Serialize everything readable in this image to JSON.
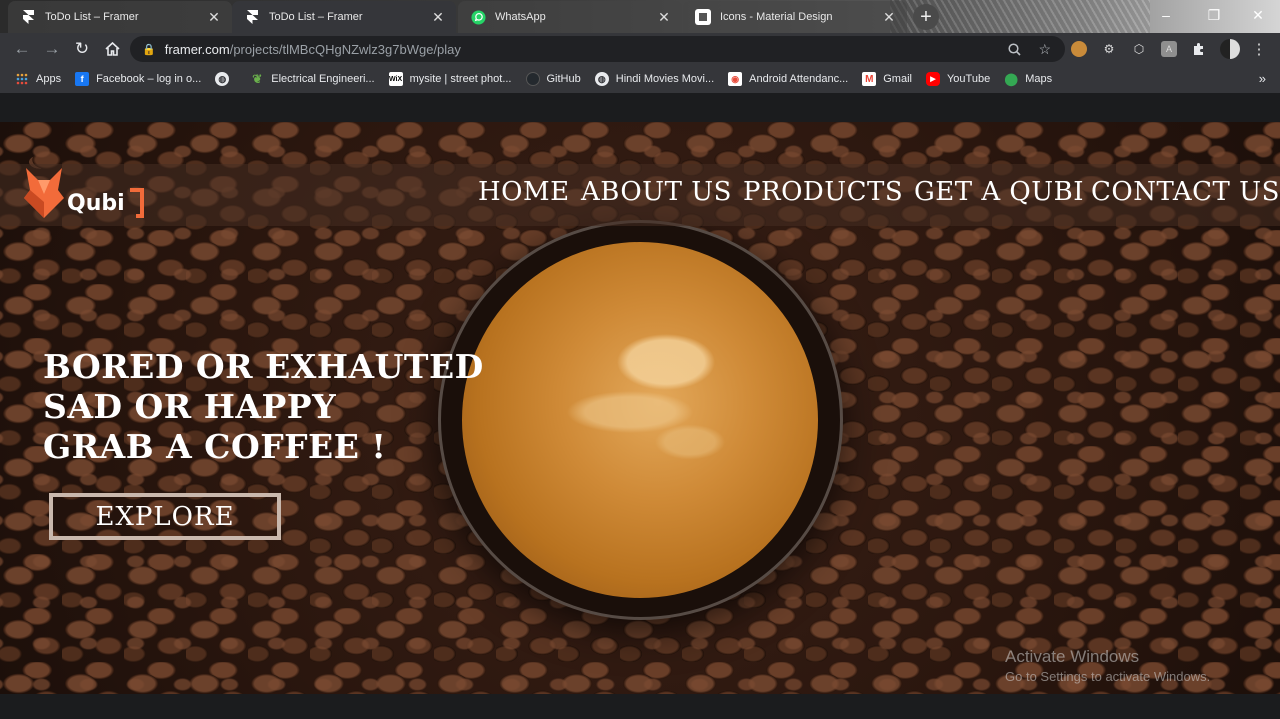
{
  "tabs": [
    {
      "title": "ToDo List – Framer",
      "favicon": "framer-icon",
      "state": "inactive"
    },
    {
      "title": "ToDo List – Framer",
      "favicon": "framer-icon",
      "state": "active"
    },
    {
      "title": "WhatsApp",
      "favicon": "whatsapp-icon",
      "state": "inactive"
    },
    {
      "title": "Icons - Material Design",
      "favicon": "material-icon",
      "state": "inactive"
    }
  ],
  "new_tab_label": "+",
  "window_controls": {
    "minimize": "–",
    "maximize": "❐",
    "close": "✕"
  },
  "address_bar": {
    "host": "framer.com",
    "path": "/projects/tlMBcQHgNZwlz3g7bWge/play"
  },
  "bookmarks": [
    {
      "label": "Apps",
      "icon": "apps-grid-icon",
      "color": "#e8eaed"
    },
    {
      "label": "Facebook – log in o...",
      "icon": "facebook-icon",
      "color": "#1877f2"
    },
    {
      "label": "",
      "icon": "globe-icon",
      "color": "#e8eaed"
    },
    {
      "label": "Electrical Engineeri...",
      "icon": "leaf-icon",
      "color": "#6ab04c"
    },
    {
      "label": "mysite | street phot...",
      "icon": "wix-icon",
      "color": "#ffffff"
    },
    {
      "label": "GitHub",
      "icon": "github-icon",
      "color": "#24292e"
    },
    {
      "label": "Hindi Movies Movi...",
      "icon": "globe-icon",
      "color": "#e8eaed"
    },
    {
      "label": "Android Attendanc...",
      "icon": "android-attendance-icon",
      "color": "#e74c3c"
    },
    {
      "label": "Gmail",
      "icon": "gmail-icon",
      "color": "#ea4335"
    },
    {
      "label": "YouTube",
      "icon": "youtube-icon",
      "color": "#ff0000"
    },
    {
      "label": "Maps",
      "icon": "maps-icon",
      "color": "#34a853"
    }
  ],
  "bookmarks_more": "»",
  "site": {
    "logo_text": "Qubi",
    "nav": [
      "HOME",
      "ABOUT US",
      "PRODUCTS",
      "GET A QUBI",
      "CONTACT US"
    ],
    "headline": [
      "BORED OR EXHAUTED",
      "SAD OR HAPPY",
      "GRAB A COFFEE !"
    ],
    "cta": "EXPLORE",
    "accent": "#f26b3a"
  },
  "watermark": {
    "title": "Activate Windows",
    "subtitle": "Go to Settings to activate Windows."
  }
}
